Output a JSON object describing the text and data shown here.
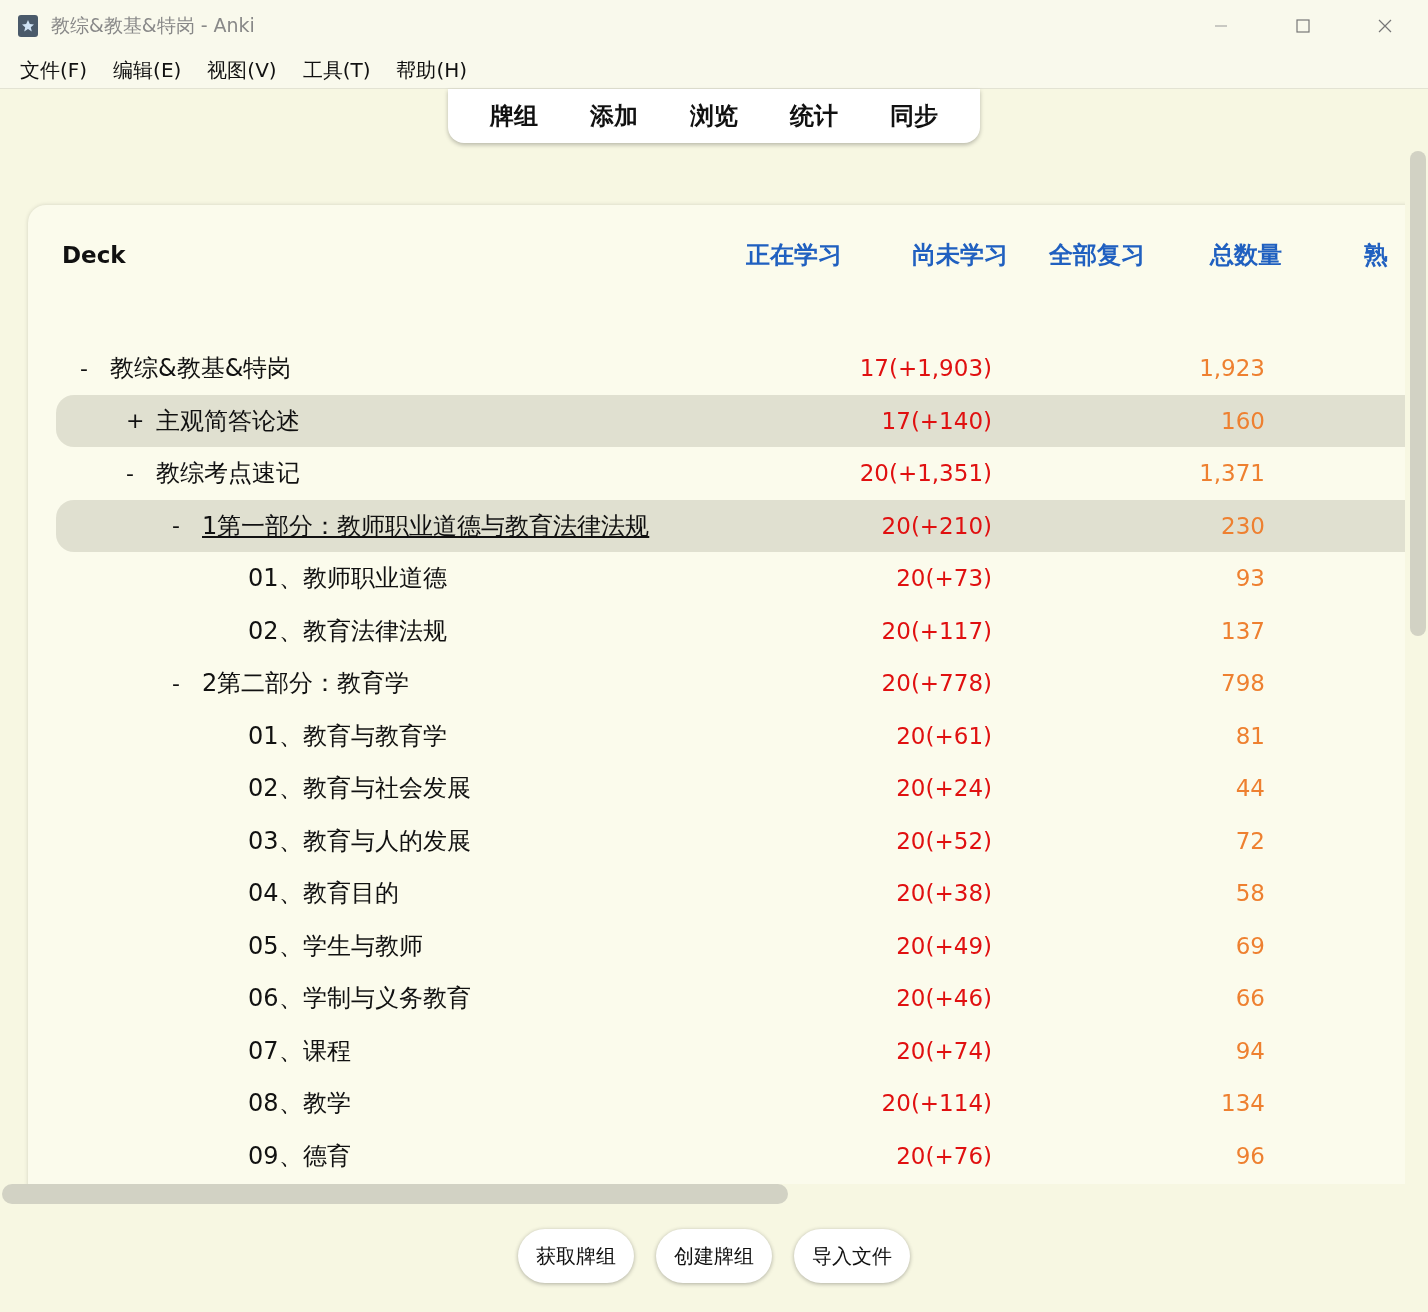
{
  "window": {
    "title": "教综&教基&特岗 - Anki"
  },
  "menu": [
    "文件(F)",
    "编辑(E)",
    "视图(V)",
    "工具(T)",
    "帮助(H)"
  ],
  "toolbar": [
    "牌组",
    "添加",
    "浏览",
    "统计",
    "同步"
  ],
  "table": {
    "columns": [
      "Deck",
      "正在学习",
      "尚未学习",
      "全部复习",
      "总数量",
      "熟"
    ],
    "decks": [
      {
        "toggle": "-",
        "name": "教综&教基&特岗",
        "new": "17(+1,903)",
        "total": "1,923",
        "highlighted": false,
        "hovered": false,
        "children": [
          {
            "toggle": "+",
            "name": "主观简答论述",
            "new": "17(+140)",
            "total": "160",
            "highlighted": true,
            "hovered": false
          },
          {
            "toggle": "-",
            "name": "教综考点速记",
            "new": "20(+1,351)",
            "total": "1,371",
            "highlighted": false,
            "hovered": false,
            "children": [
              {
                "toggle": "-",
                "name": "1第一部分：教师职业道德与教育法律法规",
                "new": "20(+210)",
                "total": "230",
                "highlighted": true,
                "hovered": true,
                "children": [
                  {
                    "name": "01、教师职业道德",
                    "new": "20(+73)",
                    "total": "93",
                    "highlighted": false,
                    "hovered": false
                  },
                  {
                    "name": "02、教育法律法规",
                    "new": "20(+117)",
                    "total": "137",
                    "highlighted": false,
                    "hovered": false
                  }
                ]
              },
              {
                "toggle": "-",
                "name": "2第二部分：教育学",
                "new": "20(+778)",
                "total": "798",
                "highlighted": false,
                "hovered": false,
                "children": [
                  {
                    "name": "01、教育与教育学",
                    "new": "20(+61)",
                    "total": "81",
                    "highlighted": false,
                    "hovered": false
                  },
                  {
                    "name": "02、教育与社会发展",
                    "new": "20(+24)",
                    "total": "44",
                    "highlighted": false,
                    "hovered": false
                  },
                  {
                    "name": "03、教育与人的发展",
                    "new": "20(+52)",
                    "total": "72",
                    "highlighted": false,
                    "hovered": false
                  },
                  {
                    "name": "04、教育目的",
                    "new": "20(+38)",
                    "total": "58",
                    "highlighted": false,
                    "hovered": false
                  },
                  {
                    "name": "05、学生与教师",
                    "new": "20(+49)",
                    "total": "69",
                    "highlighted": false,
                    "hovered": false
                  },
                  {
                    "name": "06、学制与义务教育",
                    "new": "20(+46)",
                    "total": "66",
                    "highlighted": false,
                    "hovered": false
                  },
                  {
                    "name": "07、课程",
                    "new": "20(+74)",
                    "total": "94",
                    "highlighted": false,
                    "hovered": false
                  },
                  {
                    "name": "08、教学",
                    "new": "20(+114)",
                    "total": "134",
                    "highlighted": false,
                    "hovered": false
                  },
                  {
                    "name": "09、德育",
                    "new": "20(+76)",
                    "total": "96",
                    "highlighted": false,
                    "hovered": false
                  }
                ]
              }
            ]
          }
        ]
      }
    ]
  },
  "buttons": [
    "获取牌组",
    "创建牌组",
    "导入文件"
  ]
}
